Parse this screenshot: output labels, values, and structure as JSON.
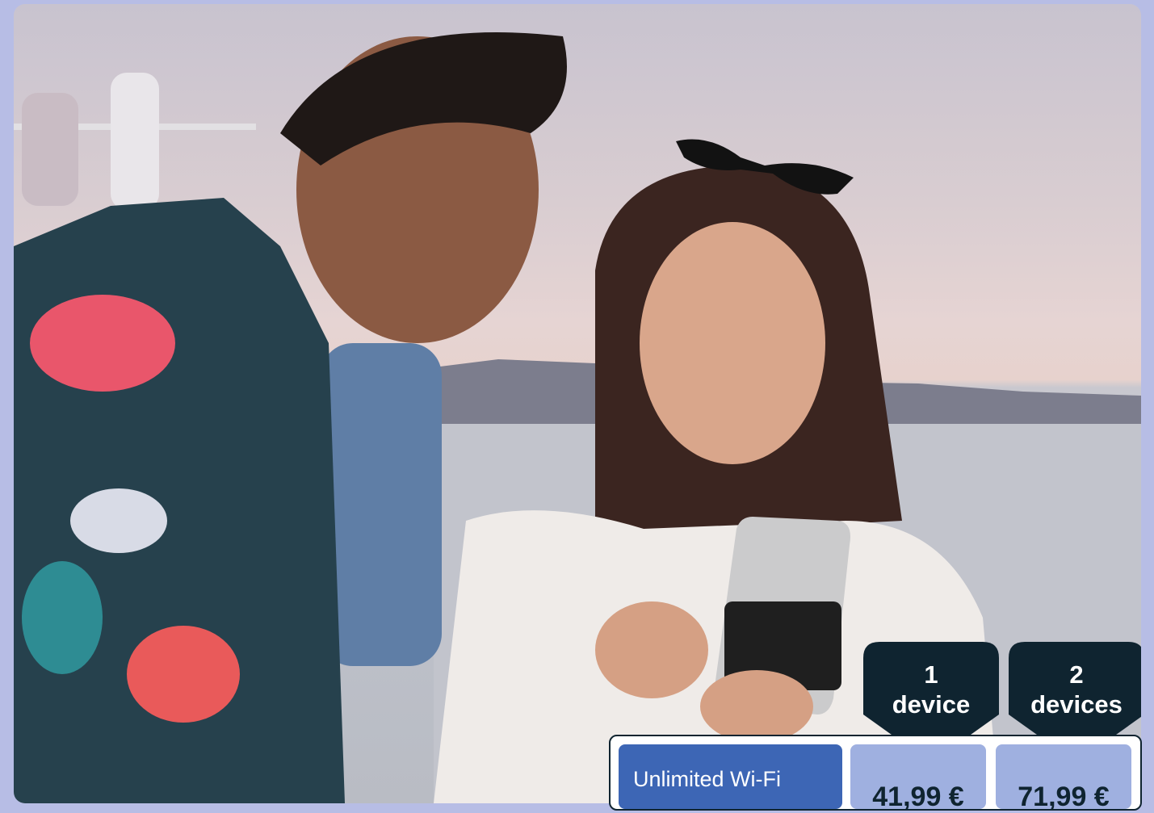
{
  "badges": [
    {
      "count": "1",
      "unit": "device"
    },
    {
      "count": "2",
      "unit": "devices"
    }
  ],
  "pricing": {
    "plan_label": "Unlimited Wi-Fi",
    "prices": [
      "41,99 €",
      "71,99 €"
    ]
  },
  "colors": {
    "page_bg": "#b7bde5",
    "badge_bg": "#0f2430",
    "plan_cell": "#3d66b5",
    "price_cell": "#9fb0e0"
  },
  "image": {
    "alt": "photo-couple-looking-at-phone-on-ship-deck"
  }
}
